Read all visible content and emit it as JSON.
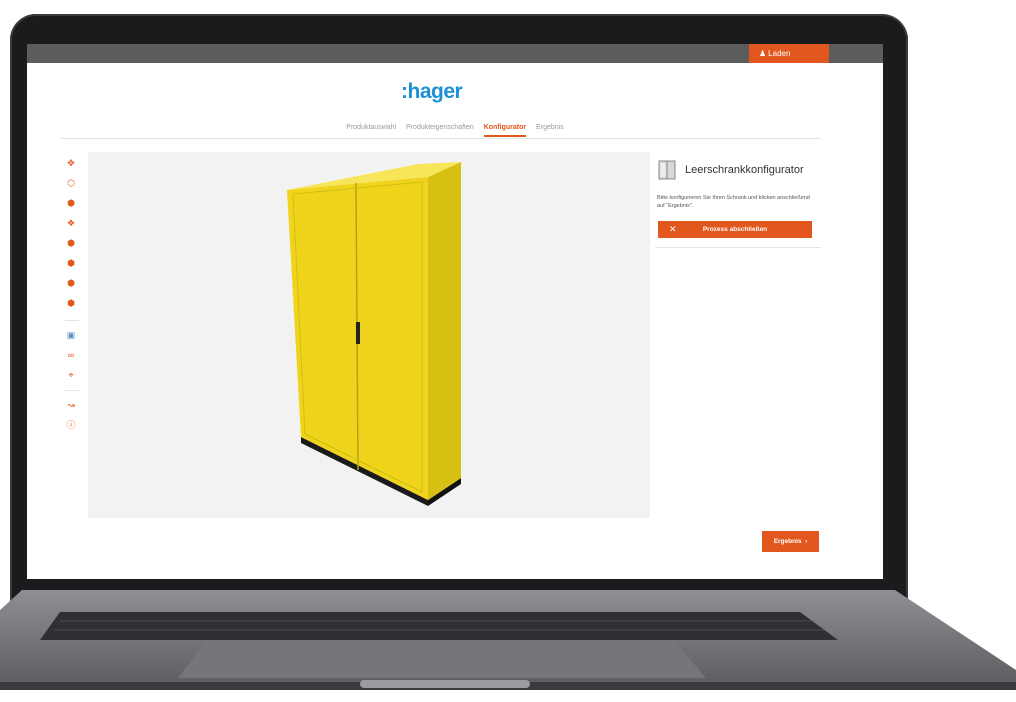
{
  "header": {
    "load_label": "Laden",
    "logo_text": ":hager"
  },
  "tabs": [
    {
      "label": "Produktauswahl",
      "active": false
    },
    {
      "label": "Produkteigenschaften",
      "active": false
    },
    {
      "label": "Konfigurator",
      "active": true
    },
    {
      "label": "Ergebnis",
      "active": false
    }
  ],
  "sidebar": {
    "icons": [
      "move-icon",
      "cube-outline-icon",
      "cube-front-icon",
      "cube-top-icon",
      "cube-left-icon",
      "cube-right-icon",
      "cube-back-icon",
      "cube-bottom-icon",
      "screenshot-icon",
      "link-icon",
      "measure-icon",
      "connection-icon",
      "help-icon"
    ]
  },
  "panel": {
    "title": "Leerschrankkonfigurator",
    "description": "Bitte konfigurieren Sie Ihren Schrank und klicken anschließend auf \"Ergebnis\".",
    "finish_label": "Prozess abschließen"
  },
  "footer": {
    "result_label": "Ergebnis"
  },
  "colors": {
    "accent": "#e2571e",
    "logo": "#1d91d6",
    "cabinet": "#f2dc1e"
  }
}
